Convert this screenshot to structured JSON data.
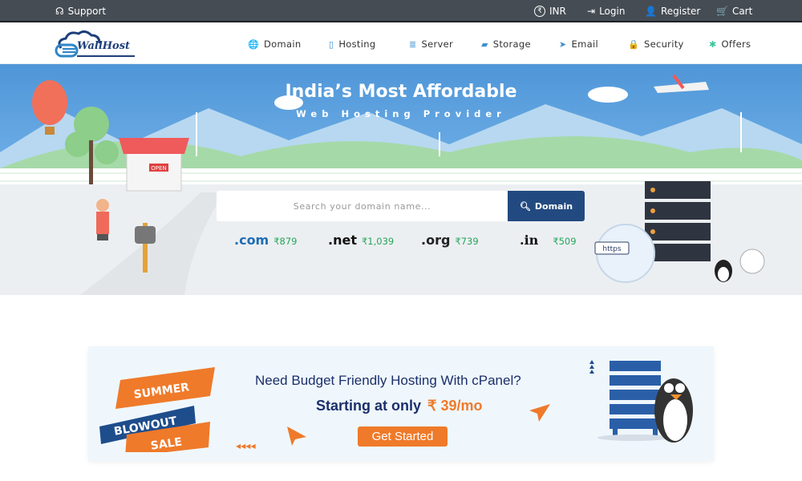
{
  "topbar": {
    "support": "Support",
    "currency": "INR",
    "login": "Login",
    "register": "Register",
    "cart": "Cart"
  },
  "logo": {
    "text": "WallHost"
  },
  "nav": [
    {
      "label": "Domain",
      "icon": "globe-icon"
    },
    {
      "label": "Hosting",
      "icon": "hosting-icon"
    },
    {
      "label": "Server",
      "icon": "server-icon"
    },
    {
      "label": "Storage",
      "icon": "folder-icon"
    },
    {
      "label": "Email",
      "icon": "send-icon"
    },
    {
      "label": "Security",
      "icon": "lock-icon"
    },
    {
      "label": "Offers",
      "icon": "offer-badge-icon"
    }
  ],
  "hero": {
    "title": "India’s Most Affordable",
    "subtitle": "Web Hosting Provider",
    "search_placeholder": "Search your domain name...",
    "search_button": "Domain",
    "shop_sign": "OPEN",
    "https_label": "https",
    "tlds": [
      {
        "name": ".com",
        "price": "₹879",
        "color": "#1f6db5"
      },
      {
        "name": ".net",
        "price": "₹1,039",
        "color": "#111111"
      },
      {
        "name": ".org",
        "price": "₹739",
        "color": "#222222"
      },
      {
        "name": ".in",
        "price": "₹509",
        "color": "#111111"
      }
    ]
  },
  "banner": {
    "badge": [
      "SUMMER",
      "BLOWOUT",
      "SALE"
    ],
    "headline": "Need Budget Friendly Hosting With cPanel?",
    "starting": "Starting at only",
    "price": "₹ 39/mo",
    "cta": "Get Started"
  },
  "colors": {
    "topbar": "#454c53",
    "primary": "#224a80",
    "accent": "#ef7a2a",
    "price_green": "#26a65b"
  }
}
